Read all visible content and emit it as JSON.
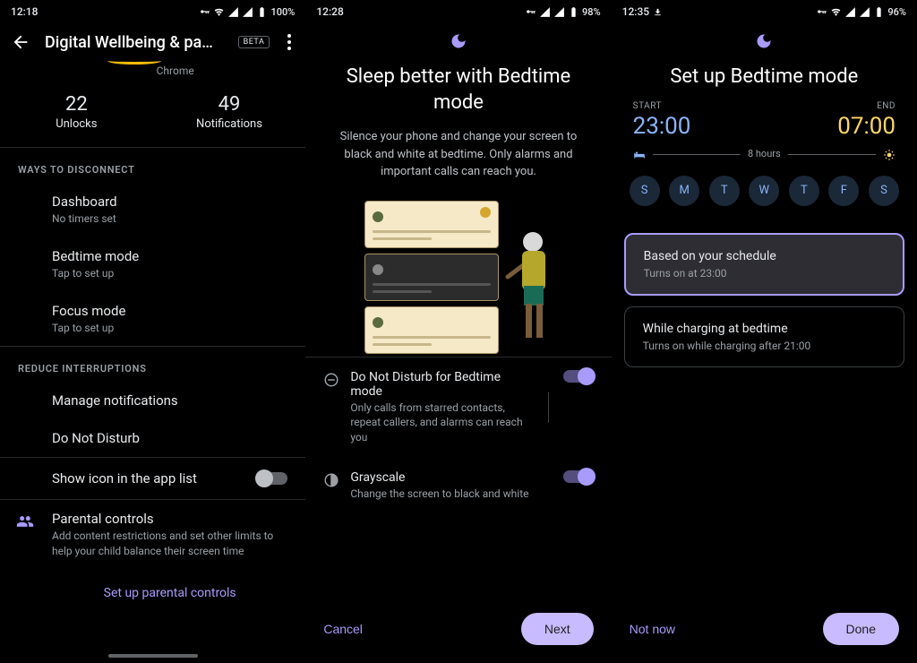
{
  "screen1": {
    "status": {
      "time": "12:18",
      "battery": "100%"
    },
    "header": {
      "title": "Digital Wellbeing & pa…",
      "badge": "BETA"
    },
    "chrome": "Chrome",
    "stats": {
      "unlocks_n": "22",
      "unlocks_l": "Unlocks",
      "notif_n": "49",
      "notif_l": "Notifications"
    },
    "ways_header": "WAYS TO DISCONNECT",
    "dashboard": {
      "t": "Dashboard",
      "s": "No timers set"
    },
    "bedtime": {
      "t": "Bedtime mode",
      "s": "Tap to set up"
    },
    "focus": {
      "t": "Focus mode",
      "s": "Tap to set up"
    },
    "reduce_header": "REDUCE INTERRUPTIONS",
    "manage_notif": "Manage notifications",
    "dnd": "Do Not Disturb",
    "show_icon": "Show icon in the app list",
    "parental": {
      "t": "Parental controls",
      "s": "Add content restrictions and set other limits to help your child balance their screen time"
    },
    "setup_link": "Set up parental controls"
  },
  "screen2": {
    "status": {
      "time": "12:28",
      "battery": "98%"
    },
    "title": "Sleep better with Bedtime mode",
    "sub": "Silence your phone and change your screen to black and white at bedtime. Only alarms and important calls can reach you.",
    "dnd": {
      "t": "Do Not Disturb for Bedtime mode",
      "s": "Only calls from starred contacts, repeat callers, and alarms can reach you"
    },
    "grayscale": {
      "t": "Grayscale",
      "s": "Change the screen to black and white"
    },
    "cancel": "Cancel",
    "next": "Next"
  },
  "screen3": {
    "status": {
      "time": "12:35",
      "battery": "96%"
    },
    "title": "Set up Bedtime mode",
    "start_l": "START",
    "start_v": "23:00",
    "end_l": "END",
    "end_v": "07:00",
    "duration": "8 hours",
    "days": [
      "S",
      "M",
      "T",
      "W",
      "T",
      "F",
      "S"
    ],
    "opt1": {
      "t": "Based on your schedule",
      "s": "Turns on at 23:00"
    },
    "opt2": {
      "t": "While charging at bedtime",
      "s": "Turns on while charging after 21:00"
    },
    "notnow": "Not now",
    "done": "Done"
  }
}
